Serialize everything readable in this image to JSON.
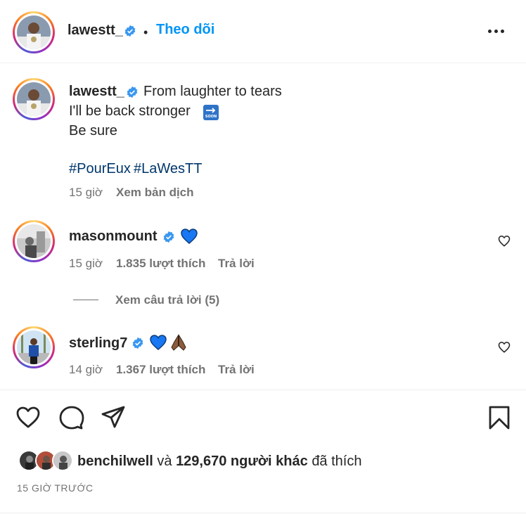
{
  "post": {
    "author": "lawestt_",
    "follow_dot": "•",
    "follow_label": "Theo dõi",
    "more_icon": "more-horizontal-icon"
  },
  "caption": {
    "author": "lawestt_",
    "line1": "From laughter to tears",
    "line2": "I'll be back stronger",
    "line2_emoji": "soon-arrow-emoji",
    "line3": "Be sure",
    "hashtag1": "#PourEux",
    "hashtag2": "#LaWesTT",
    "time": "15 giờ",
    "translate": "Xem bản dịch"
  },
  "comments": [
    {
      "user": "masonmount",
      "text": "💙",
      "time": "15 giờ",
      "likes": "1.835 lượt thích",
      "reply": "Trả lời",
      "view_replies": "Xem câu trả lời (5)"
    },
    {
      "user": "sterling7",
      "text": "💙🙏🏾",
      "time": "14 giờ",
      "likes": "1.367 lượt thích",
      "reply": "Trả lời"
    }
  ],
  "actions": {
    "like": "heart-icon",
    "comment": "comment-icon",
    "share": "share-icon",
    "save": "bookmark-icon"
  },
  "likes": {
    "user": "benchilwell",
    "conj": "và",
    "others": "129,670 người khác",
    "suffix": "đã thích"
  },
  "timestamp": "15 GIỜ TRƯỚC",
  "colors": {
    "link": "#0095f6",
    "verified": "#3897f0",
    "hashtag": "#00376b",
    "muted": "#737373",
    "heart_blue": "#1877f2"
  }
}
